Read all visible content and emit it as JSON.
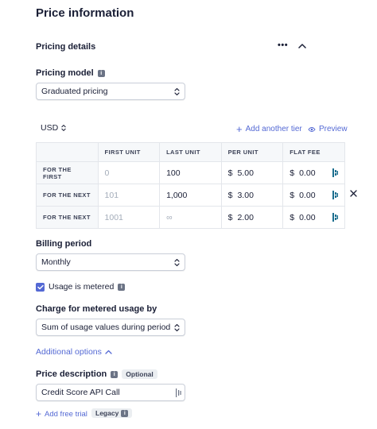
{
  "page_title": "Price information",
  "pricing_details": {
    "title": "Pricing details",
    "more_label": "•••",
    "pricing_model_label": "Pricing model",
    "pricing_model_value": "Graduated pricing"
  },
  "currency": "USD",
  "add_tier_label": "Add another tier",
  "preview_label": "Preview",
  "tiers_table": {
    "headers": [
      "FIRST UNIT",
      "LAST UNIT",
      "PER UNIT",
      "FLAT FEE"
    ],
    "currency_symbol": "$",
    "rows": [
      {
        "label": "FOR THE FIRST",
        "first_unit": "0",
        "last_unit": "100",
        "per_unit": "5.00",
        "flat_fee": "0.00"
      },
      {
        "label": "FOR THE NEXT",
        "first_unit": "101",
        "last_unit": "1,000",
        "per_unit": "3.00",
        "flat_fee": "0.00"
      },
      {
        "label": "FOR THE NEXT",
        "first_unit": "1001",
        "last_unit": "∞",
        "per_unit": "2.00",
        "flat_fee": "0.00"
      }
    ]
  },
  "billing_period": {
    "label": "Billing period",
    "value": "Monthly"
  },
  "usage_metered": {
    "label": "Usage is metered",
    "checked": true
  },
  "charge_metered": {
    "label": "Charge for metered usage by",
    "value": "Sum of usage values during period"
  },
  "additional_options_label": "Additional options",
  "price_description": {
    "label": "Price description",
    "optional_badge": "Optional",
    "value": "Credit Score API Call"
  },
  "free_trial": {
    "label": "Add free trial",
    "badge": "Legacy"
  },
  "colors": {
    "accent": "#5469d4",
    "teal_icon": "#1d6f8f",
    "text": "#1a1f36"
  }
}
